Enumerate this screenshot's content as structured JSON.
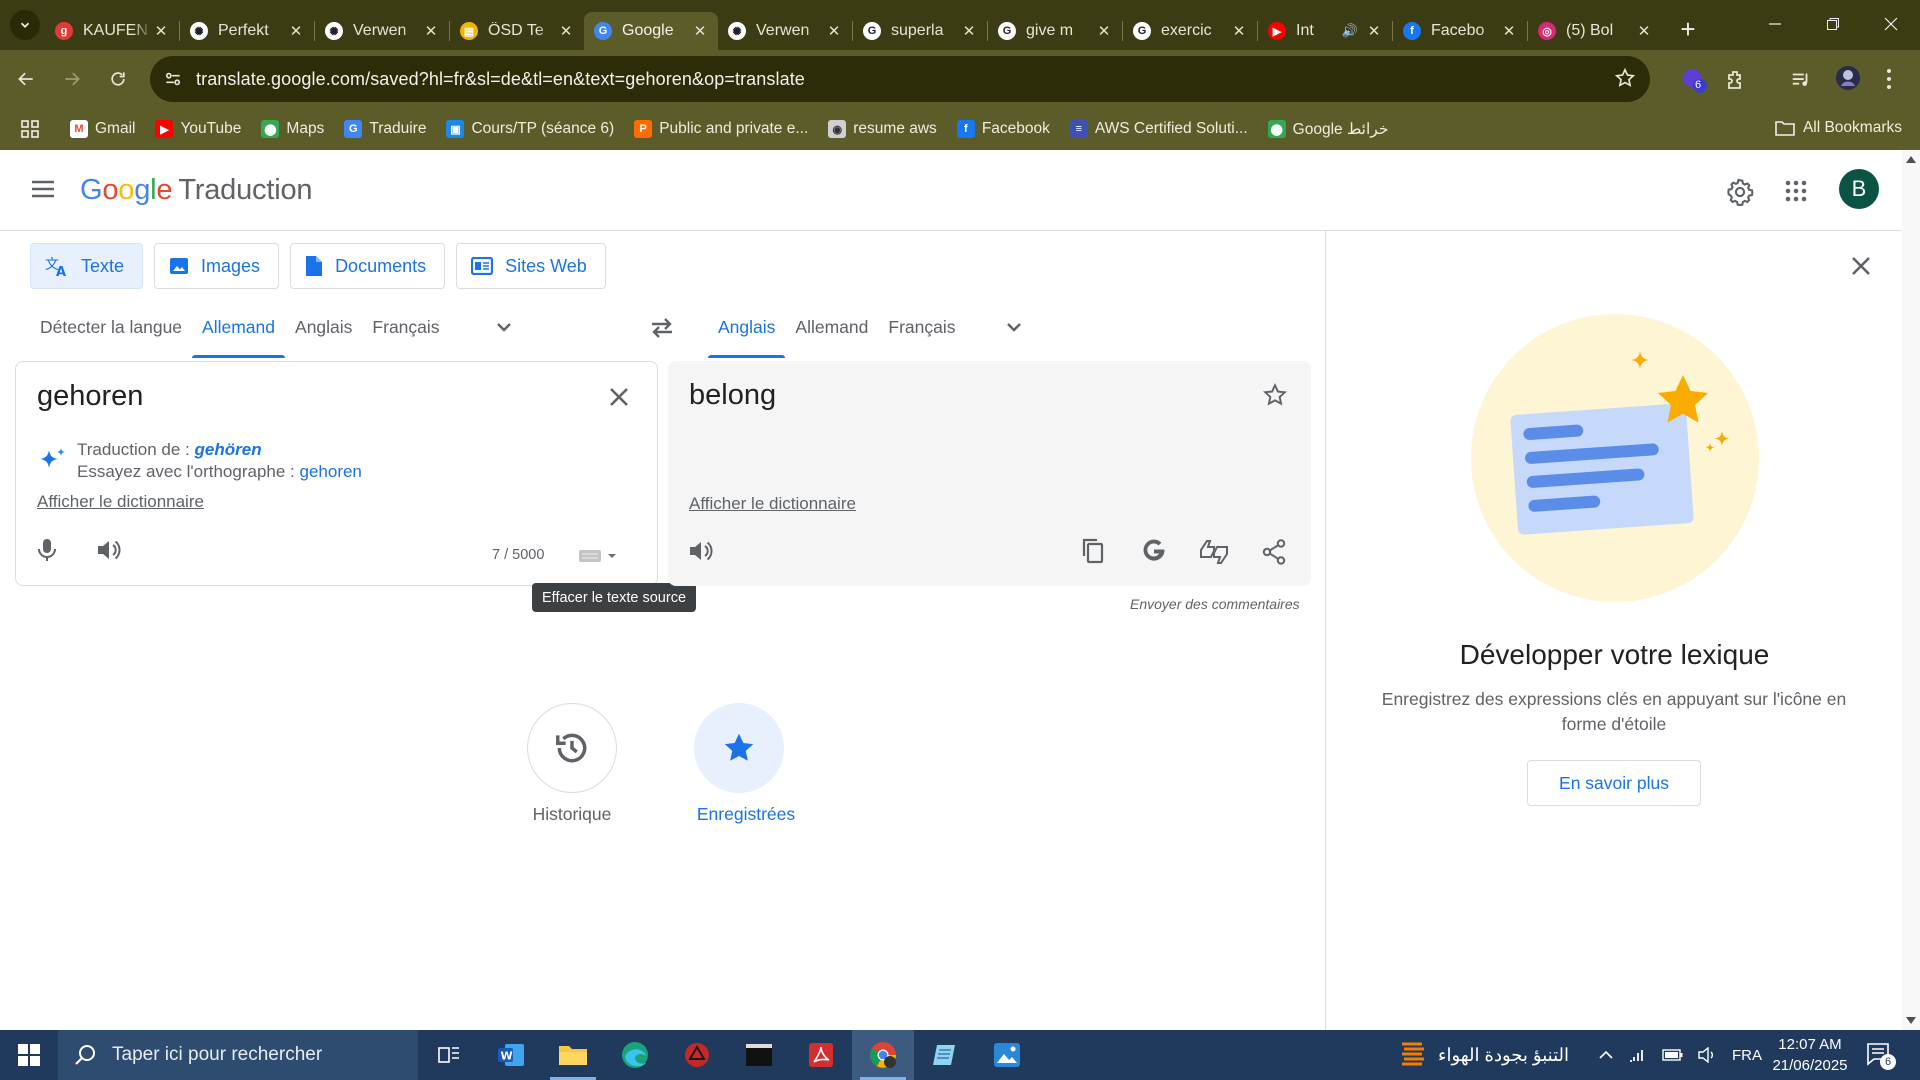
{
  "browser": {
    "tabs": [
      {
        "label": "KAUFEN",
        "icon": "g-icon",
        "fav_bg": "#e53935",
        "fav_text": "g"
      },
      {
        "label": "Perfekt",
        "icon": "chatgpt-icon",
        "fav_bg": "#ffffff",
        "fav_text": "✺"
      },
      {
        "label": "Verwen",
        "icon": "chatgpt-icon",
        "fav_bg": "#ffffff",
        "fav_text": "✺"
      },
      {
        "label": "ÖSD Te",
        "icon": "slides-icon",
        "fav_bg": "#f4b400",
        "fav_text": "▤"
      },
      {
        "label": "Google",
        "icon": "google-translate-icon",
        "fav_bg": "#4285f4",
        "fav_text": "G",
        "active": true
      },
      {
        "label": "Verwen",
        "icon": "chatgpt-icon",
        "fav_bg": "#ffffff",
        "fav_text": "✺"
      },
      {
        "label": "superla",
        "icon": "google-icon",
        "fav_bg": "#ffffff",
        "fav_text": "G"
      },
      {
        "label": "give m",
        "icon": "google-icon",
        "fav_bg": "#ffffff",
        "fav_text": "G"
      },
      {
        "label": "exercic",
        "icon": "google-icon",
        "fav_bg": "#ffffff",
        "fav_text": "G"
      },
      {
        "label": "Int",
        "icon": "youtube-icon",
        "fav_bg": "#ff0000",
        "fav_text": "▶",
        "sound": true
      },
      {
        "label": "Facebo",
        "icon": "facebook-icon",
        "fav_bg": "#1877f2",
        "fav_text": "f"
      },
      {
        "label": "(5) Bol",
        "icon": "instagram-icon",
        "fav_bg": "#d62976",
        "fav_text": "◎"
      }
    ],
    "url": "translate.google.com/saved?hl=fr&sl=de&tl=en&text=gehoren&op=translate",
    "extension_badge": "6",
    "bookmarks": [
      {
        "label": "Gmail",
        "icon": "gmail-icon",
        "bg": "#ffffff",
        "fg": "#ea4335",
        "glyph": "M"
      },
      {
        "label": "YouTube",
        "icon": "youtube-icon",
        "bg": "#ff0000",
        "fg": "#ffffff",
        "glyph": "▶"
      },
      {
        "label": "Maps",
        "icon": "maps-icon",
        "bg": "#34a853",
        "fg": "#ffffff",
        "glyph": "⬤"
      },
      {
        "label": "Traduire",
        "icon": "translate-icon",
        "bg": "#4285f4",
        "fg": "#ffffff",
        "glyph": "G"
      },
      {
        "label": "Cours/TP (séance 6)",
        "icon": "classroom-icon",
        "bg": "#1e88e5",
        "fg": "#ffffff",
        "glyph": "▣"
      },
      {
        "label": "Public and private e...",
        "icon": "pdf-icon",
        "bg": "#ff6d00",
        "fg": "#ffffff",
        "glyph": "P"
      },
      {
        "label": "resume aws",
        "icon": "globe-icon",
        "bg": "#d0d0d0",
        "fg": "#333333",
        "glyph": "◉"
      },
      {
        "label": "Facebook",
        "icon": "facebook-icon",
        "bg": "#1877f2",
        "fg": "#ffffff",
        "glyph": "f"
      },
      {
        "label": "AWS Certified Soluti...",
        "icon": "aws-icon",
        "bg": "#3f51b5",
        "fg": "#ffffff",
        "glyph": "≡"
      },
      {
        "label": "Google خرائط",
        "icon": "maps-icon",
        "bg": "#34a853",
        "fg": "#ffffff",
        "glyph": "⬤"
      }
    ],
    "all_bookmarks": "All Bookmarks"
  },
  "app": {
    "logo_google": [
      "G",
      "o",
      "o",
      "g",
      "l",
      "e"
    ],
    "product": "Traduction",
    "avatar_letter": "B",
    "modes": [
      "Texte",
      "Images",
      "Documents",
      "Sites Web"
    ],
    "source_langs": [
      "Détecter la langue",
      "Allemand",
      "Anglais",
      "Français"
    ],
    "target_langs": [
      "Anglais",
      "Allemand",
      "Français"
    ],
    "source_text": "gehoren",
    "target_text": "belong",
    "translated_from_label": "Traduction de :",
    "translated_from_word": "gehören",
    "try_spelling_label": "Essayez avec l'orthographe :",
    "try_spelling_word": "gehoren",
    "show_dictionary": "Afficher le dictionnaire",
    "char_count": "7 / 5000",
    "tooltip": "Effacer le texte source",
    "feedback": "Envoyer des commentaires",
    "history_label": "Historique",
    "saved_label": "Enregistrées",
    "panel_title": "Développer votre lexique",
    "panel_text": "Enregistrez des expressions clés en appuyant sur l'icône en forme d'étoile",
    "panel_button": "En savoir plus"
  },
  "taskbar": {
    "search_placeholder": "Taper ici pour rechercher",
    "weather": "التنبؤ بجودة الهواء",
    "language": "FRA",
    "time": "12:07 AM",
    "date": "21/06/2025",
    "notification_count": "6"
  }
}
